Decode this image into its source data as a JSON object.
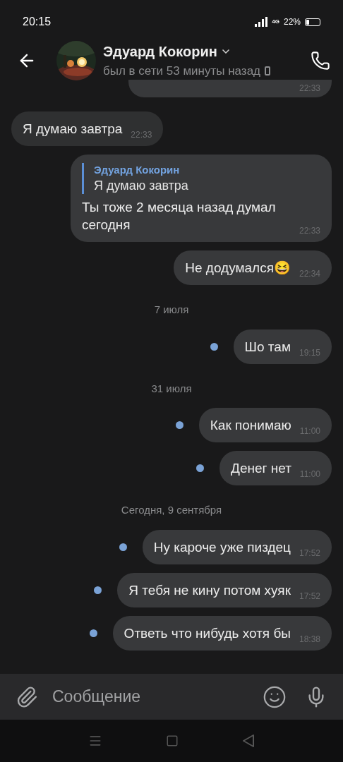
{
  "status_bar": {
    "time": "20:15",
    "network": "4G",
    "battery": "22%"
  },
  "header": {
    "name": "Эдуард Кокорин",
    "status": "был в сети 53 минуты назад"
  },
  "messages": [
    {
      "kind": "partial",
      "time": "22:33"
    },
    {
      "kind": "incoming",
      "unread": false,
      "text": "Я думаю завтра",
      "time": "22:33"
    },
    {
      "kind": "outgoing",
      "unread": false,
      "reply": {
        "author": "Эдуард Кокорин",
        "text": "Я думаю завтра"
      },
      "text": "Ты тоже 2 месяца назад думал сегодня",
      "time": "22:33"
    },
    {
      "kind": "outgoing",
      "unread": false,
      "text": "Не додумался😆",
      "time": "22:34"
    },
    {
      "kind": "date",
      "text": "7 июля"
    },
    {
      "kind": "outgoing",
      "unread": true,
      "text": "Шо там",
      "time": "19:15"
    },
    {
      "kind": "date",
      "text": "31 июля"
    },
    {
      "kind": "outgoing",
      "unread": true,
      "text": "Как понимаю",
      "time": "11:00"
    },
    {
      "kind": "outgoing",
      "unread": true,
      "text": "Денег нет",
      "time": "11:00"
    },
    {
      "kind": "date",
      "text": "Сегодня, 9 сентября"
    },
    {
      "kind": "outgoing",
      "unread": true,
      "text": "Ну кароче уже пиздец",
      "time": "17:52"
    },
    {
      "kind": "outgoing",
      "unread": true,
      "text": "Я тебя не кину потом хуяк",
      "time": "17:52"
    },
    {
      "kind": "outgoing",
      "unread": true,
      "text": "Ответь что нибудь хотя бы",
      "time": "18:38"
    }
  ],
  "composer": {
    "placeholder": "Сообщение"
  }
}
